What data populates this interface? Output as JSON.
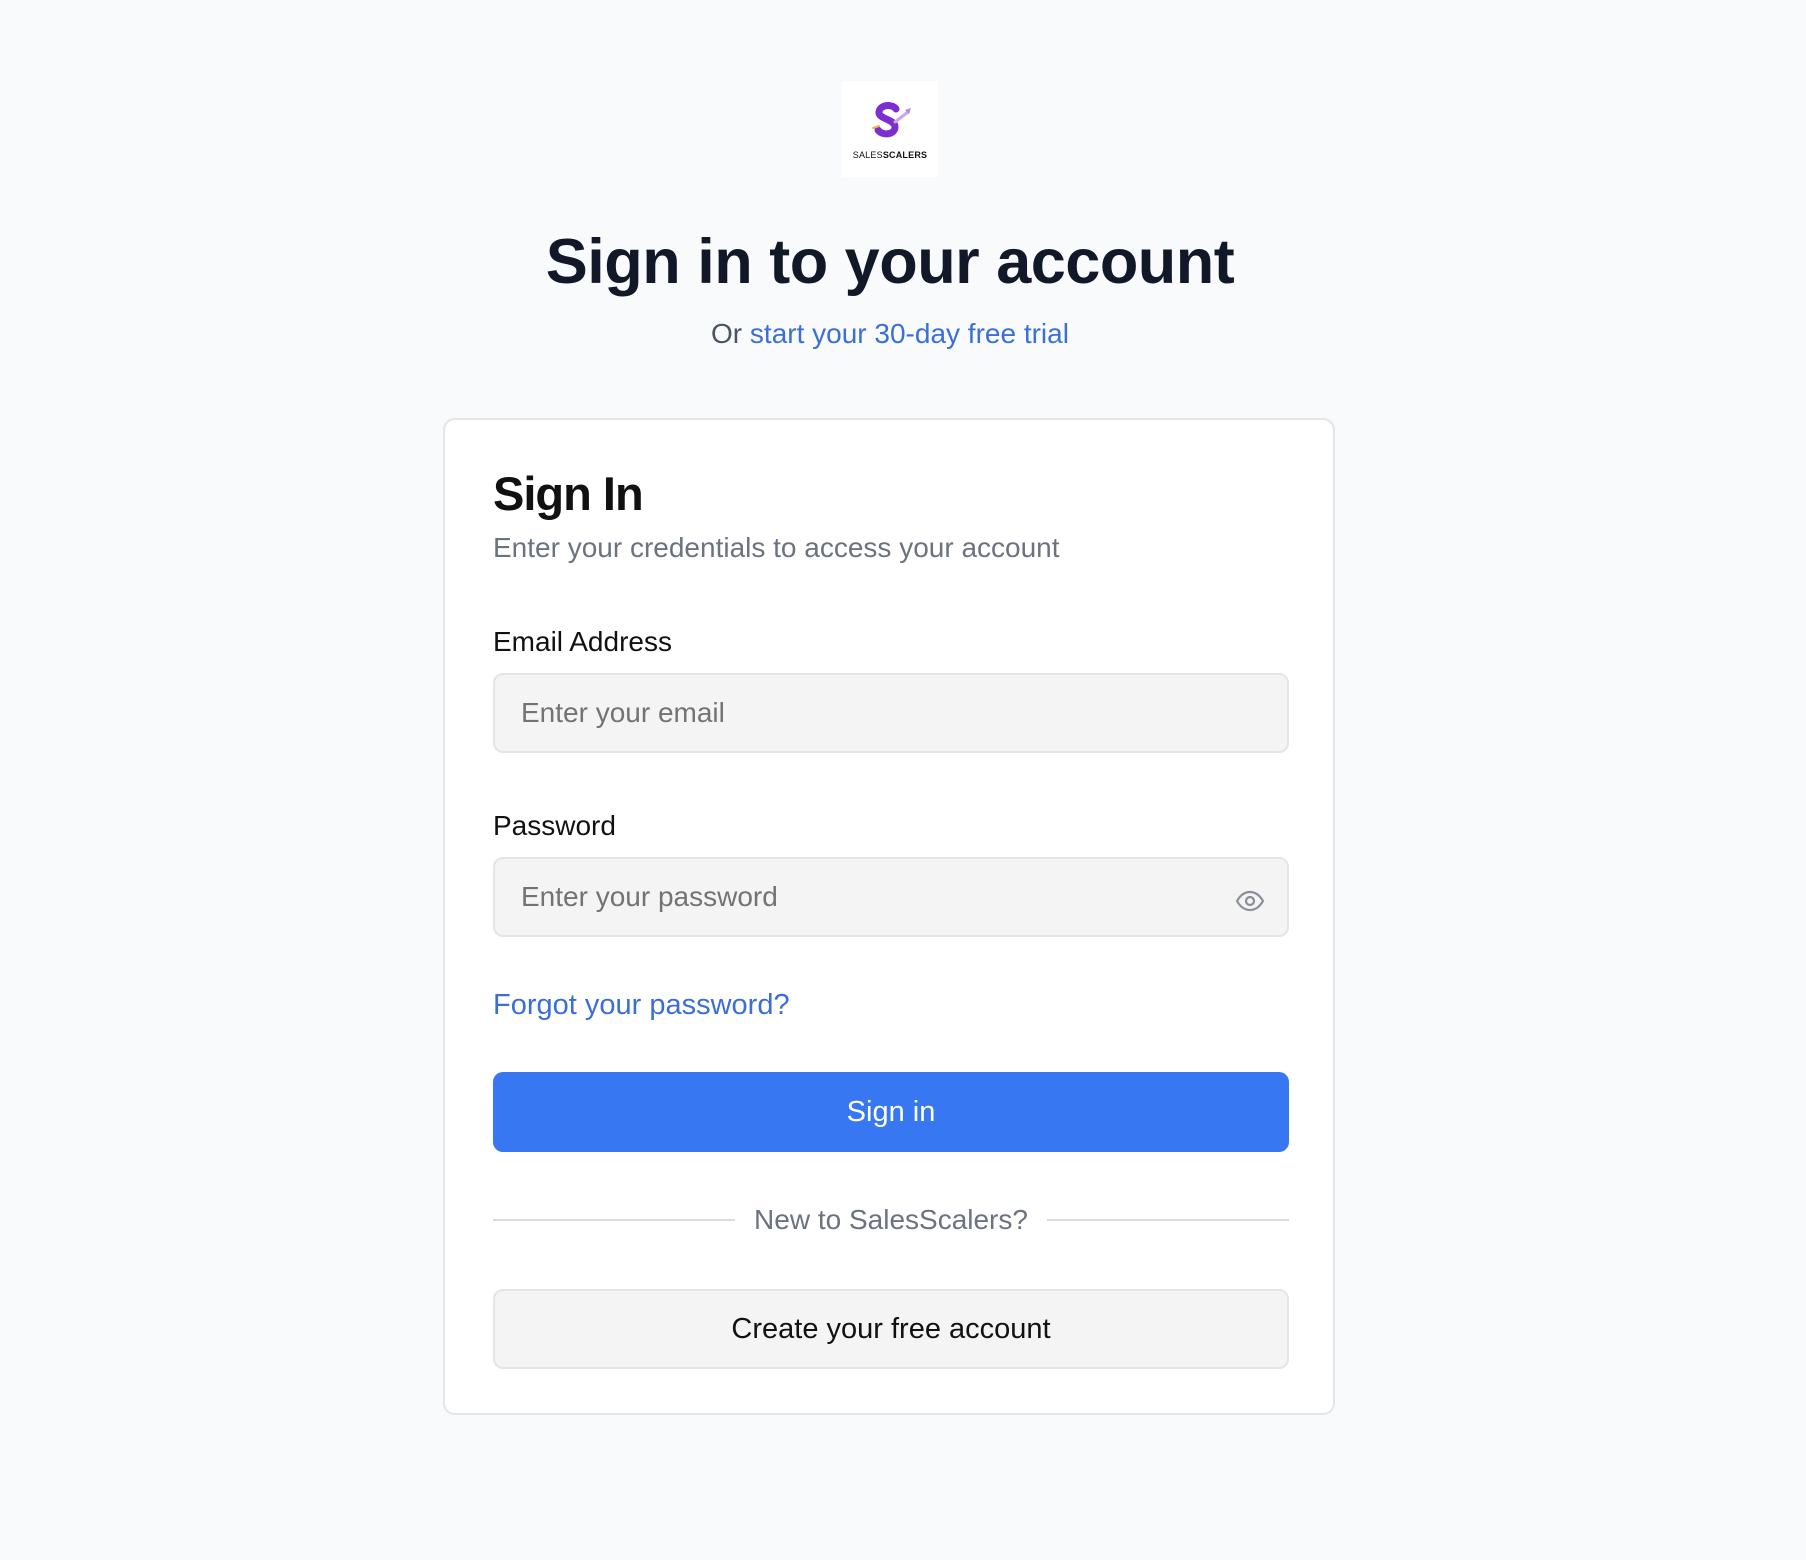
{
  "brand": {
    "logo_icon": "salesscalers-logo-icon",
    "logo_word_light": "SALES",
    "logo_word_bold": "SCALERS",
    "accent_color": "#3777f2",
    "link_color": "#3b6fd6",
    "logo_color": "#7b2fd0"
  },
  "header": {
    "title": "Sign in to your account",
    "subtitle_prefix": "Or",
    "trial_link": "start your 30-day free trial"
  },
  "card": {
    "title": "Sign In",
    "description": "Enter your credentials to access your account",
    "email": {
      "label": "Email Address",
      "placeholder": "Enter your email",
      "value": ""
    },
    "password": {
      "label": "Password",
      "placeholder": "Enter your password",
      "value": "",
      "toggle_icon": "eye-icon"
    },
    "forgot_link": "Forgot your password?",
    "sign_in_button": "Sign in",
    "divider_text": "New to SalesScalers?",
    "create_account_button": "Create your free account"
  }
}
